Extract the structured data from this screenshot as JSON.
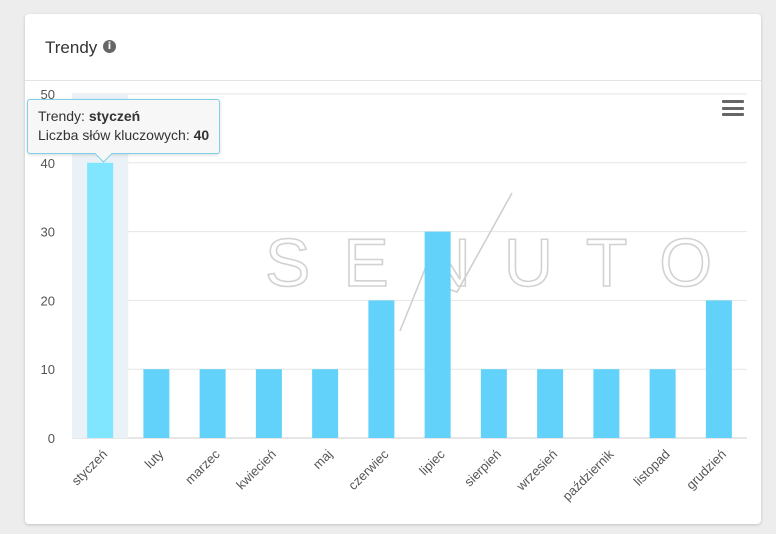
{
  "card": {
    "title": "Trendy",
    "info_icon": "i"
  },
  "tooltip": {
    "series_label": "Trendy:",
    "category": "styczeń",
    "value_label": "Liczba słów kluczowych:",
    "value": "40"
  },
  "watermark": "SENUTO",
  "chart_data": {
    "type": "bar",
    "categories": [
      "styczeń",
      "luty",
      "marzec",
      "kwiecień",
      "maj",
      "czerwiec",
      "lipiec",
      "sierpień",
      "wrzesień",
      "październik",
      "listopad",
      "grudzień"
    ],
    "values": [
      40,
      10,
      10,
      10,
      10,
      20,
      30,
      10,
      10,
      10,
      10,
      20
    ],
    "ylim": [
      0,
      50
    ],
    "yticks": [
      0,
      10,
      20,
      30,
      40,
      50
    ],
    "highlighted_category": "styczeń",
    "colors": {
      "bar": "#62d2fa",
      "bar_highlight": "#80e6ff",
      "hover_band": "#eaf2f8",
      "grid": "#e6e6e6",
      "axis": "#cccccc"
    },
    "grid": true
  }
}
